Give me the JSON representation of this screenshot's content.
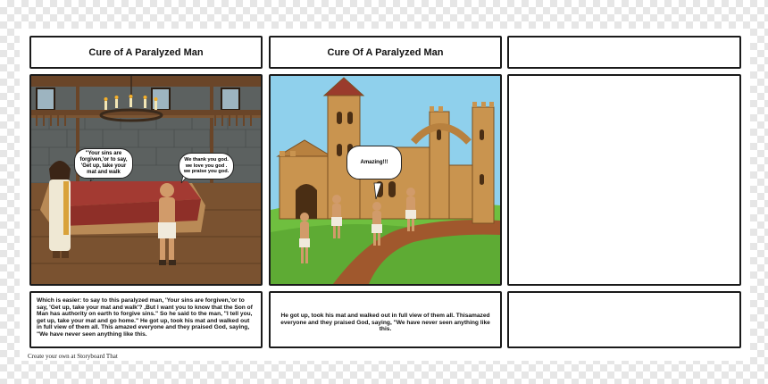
{
  "panels": [
    {
      "title": "Cure of A Paralyzed Man",
      "bubbles": {
        "left": "\"Your sins are forgiven,'or to say, 'Get up, take your mat and walk",
        "right": "We thank you god. we love you god . we praise you god."
      },
      "caption": "Which is easier: to say to this paralyzed man, 'Your sins are forgiven,'or to say, 'Get up, take your mat and walk'? ,But I want you to know that the Son of Man has authority on earth to forgive sins.\" So he said to the man, \"I tell you, get up, take your mat and go home.\" He got up, took his mat and walked out in full view of them all. This amazed everyone and they praised God, saying, \"We have never seen anything like this."
    },
    {
      "title": "Cure Of A Paralyzed Man",
      "bubbles": {
        "center": "Amazing!!!"
      },
      "caption": "He got up, took his mat and walked out in full view of them all. Thisamazed everyone and they praised God, saying, \"We have never seen anything like this."
    },
    {
      "title": "",
      "caption": ""
    }
  ],
  "footer": "Create your own at Storyboard That",
  "colors": {
    "border": "#1a1a1a",
    "sky": "#8fd0ec",
    "grass": "#6fbf3f",
    "path": "#a0582d",
    "stone": "#c9944f",
    "mat": "#a33a32",
    "wall": "#6b6f6e",
    "wood": "#6a4528"
  }
}
